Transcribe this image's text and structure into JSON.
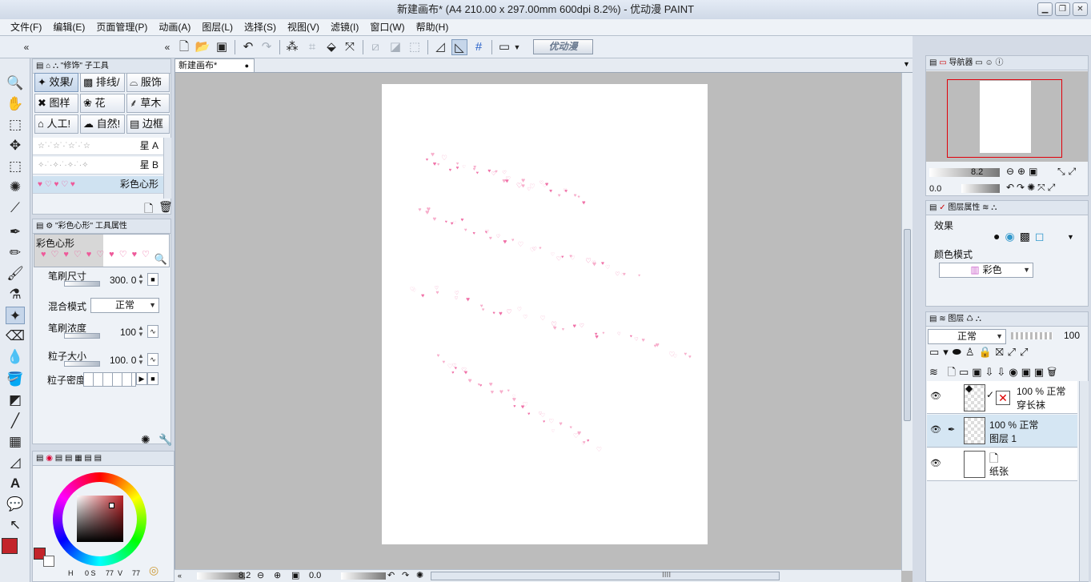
{
  "window": {
    "title": "新建画布* (A4 210.00 x 297.00mm 600dpi 8.2%)  - 优动漫 PAINT"
  },
  "menu": [
    "文件(F)",
    "编辑(E)",
    "页面管理(P)",
    "动画(A)",
    "图层(L)",
    "选择(S)",
    "视图(V)",
    "滤镜(I)",
    "窗口(W)",
    "帮助(H)"
  ],
  "toolbar": {
    "logo_label": "优动漫"
  },
  "sub_tool_panel": {
    "title": "\"修饰\" 子工具",
    "groups": [
      "效果/",
      "排线/",
      "服饰",
      "图样",
      "花",
      "草木",
      "人工!",
      "自然!",
      "边框"
    ],
    "brushes": [
      "星 A",
      "星 B",
      "彩色心形"
    ]
  },
  "tool_property": {
    "title": "\"彩色心形\" 工具属性",
    "preview_name": "彩色心形",
    "brush_size_label": "笔刷尺寸",
    "brush_size_value": "300. 0",
    "blend_label": "混合模式",
    "blend_value": "正常",
    "density_label": "笔刷浓度",
    "density_value": "100",
    "particle_label": "粒子大小",
    "particle_value": "100. 0",
    "particle_density_label": "粒子密度"
  },
  "color": {
    "main": "#c3242a",
    "h_label": "H",
    "s_label": "0 S",
    "s_value": "77",
    "v_label": "V",
    "v_value": "77"
  },
  "canvas": {
    "tab_label": "新建画布*",
    "zoom": "8.2",
    "angle": "0.0",
    "hscroll_label": "IIII"
  },
  "navigator": {
    "tab": "导航器",
    "zoom": "8.2",
    "angle": "0.0"
  },
  "layer_property": {
    "tab": "图层属性",
    "effect_label": "效果",
    "color_mode_label": "颜色模式",
    "color_mode_value": "彩色"
  },
  "layers_panel": {
    "tab": "图层",
    "blend": "正常",
    "opacity": "100",
    "layers": [
      {
        "percent": "100 % 正常",
        "name": "穿长袜"
      },
      {
        "percent": "100 % 正常",
        "name": "图层 1"
      },
      {
        "percent": "",
        "name": "纸张"
      }
    ]
  }
}
